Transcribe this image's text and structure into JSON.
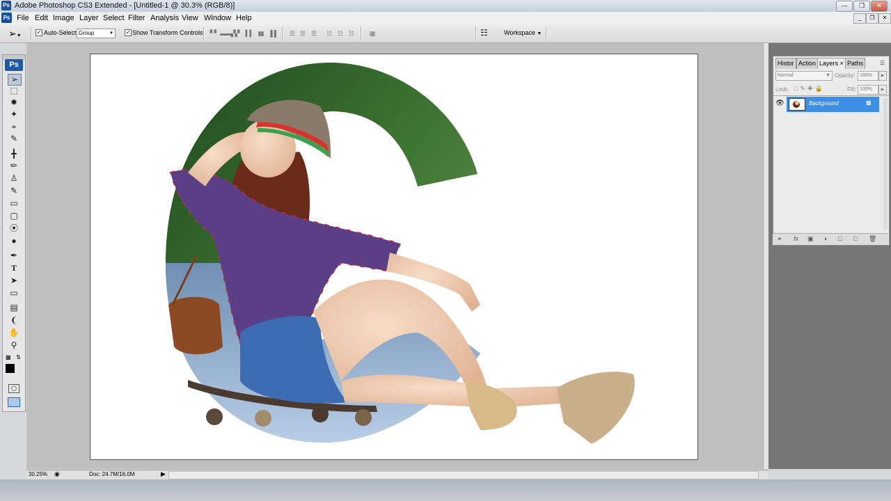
{
  "window": {
    "title": "Adobe Photoshop CS3 Extended - [Untitled-1 @ 30.3% (RGB/8)]",
    "app_icon": "Ps",
    "controls": [
      "minimize-icon",
      "restore-icon",
      "close-icon"
    ]
  },
  "menu": [
    "File",
    "Edit",
    "Image",
    "Layer",
    "Select",
    "Filter",
    "Analysis",
    "View",
    "Window",
    "Help"
  ],
  "options": {
    "auto_select_label": "Auto-Select:",
    "auto_select_checked": true,
    "auto_select_value": "Group",
    "show_transform_label": "Show Transform Controls",
    "show_transform_checked": true,
    "workspace_label": "Workspace"
  },
  "toolbox": {
    "logo": "Ps",
    "tools": [
      "move",
      "marquee",
      "lasso",
      "magic-wand",
      "crop",
      "slice",
      "healing",
      "brush",
      "clone-stamp",
      "history-brush",
      "eraser",
      "gradient",
      "blur",
      "dodge",
      "pen",
      "type",
      "path-select",
      "shape",
      "notes",
      "eyedropper",
      "hand",
      "zoom"
    ],
    "active_tool": "move",
    "foreground_color": "#000000",
    "background_color": "#ffffff"
  },
  "layers_panel": {
    "tabs": [
      "Histor",
      "Action",
      "Layers",
      "Paths"
    ],
    "active_tab": "Layers",
    "blend_mode": "Normal",
    "opacity_label": "Opacity:",
    "opacity_value": "100%",
    "lock_label": "Lock:",
    "fill_label": "Fill:",
    "fill_value": "100%",
    "layers": [
      {
        "name": "Background",
        "visible": true,
        "locked": true,
        "selected": true
      }
    ]
  },
  "status": {
    "zoom": "30.25%",
    "doc": "Doc: 24.7M/16.0M"
  },
  "colors": {
    "accent": "#3d8ee5",
    "canvas_bg": "#ffffff",
    "work_area": "#c0c0c0",
    "dock_bg": "#767676"
  }
}
